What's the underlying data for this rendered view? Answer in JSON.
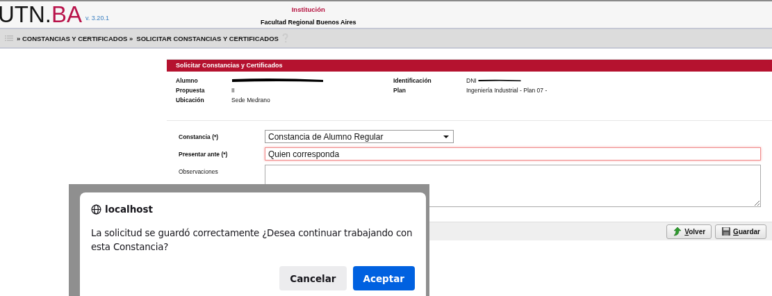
{
  "header": {
    "logo": [
      {
        "text": "UTN.",
        "color": "#151515"
      },
      {
        "text": "BA",
        "color": "#b8124a"
      }
    ],
    "version": "v. 3.20.1",
    "institution_label": "Institución",
    "institution": "Facultad Regional Buenos Aires"
  },
  "breadcrumb": [
    "» CONSTANCIAS Y CERTIFICADOS »",
    "SOLICITAR CONSTANCIAS Y CERTIFICADOS"
  ],
  "panel": {
    "title": "Solicitar Constancias y Certificados",
    "info": [
      {
        "label": "Alumno",
        "redacted": true
      },
      {
        "label": "Identificación",
        "value": "DNI",
        "redacted": true
      },
      {
        "label": "Propuesta",
        "value": "II",
        "redacted": false
      },
      {
        "label": "Plan",
        "value": "Ingeniería Industrial - Plan 07 -",
        "redacted": false
      },
      {
        "label": "Ubicación",
        "value": "Sede Medrano",
        "redacted": false
      }
    ],
    "fields": [
      {
        "kind": "select",
        "label": "Constancia (*)",
        "value": "Constancia de Alumno Regular",
        "invalid": false
      },
      {
        "kind": "text",
        "label": "Presentar ante (*)",
        "value": "Quien corresponda",
        "invalid": true
      },
      {
        "kind": "textarea",
        "label": "Observaciones",
        "invalid": false
      }
    ],
    "buttons": [
      {
        "kind": "back",
        "label": "Volver"
      },
      {
        "kind": "save",
        "label": "Guardar"
      }
    ]
  },
  "dialog": {
    "origin": "localhost",
    "message": "La solicitud se guardó correctamente ¿Desea continuar trabajando con esta Constancia?",
    "buttons": [
      {
        "label": "Cancelar",
        "primary": false
      },
      {
        "label": "Aceptar",
        "primary": true
      }
    ]
  }
}
